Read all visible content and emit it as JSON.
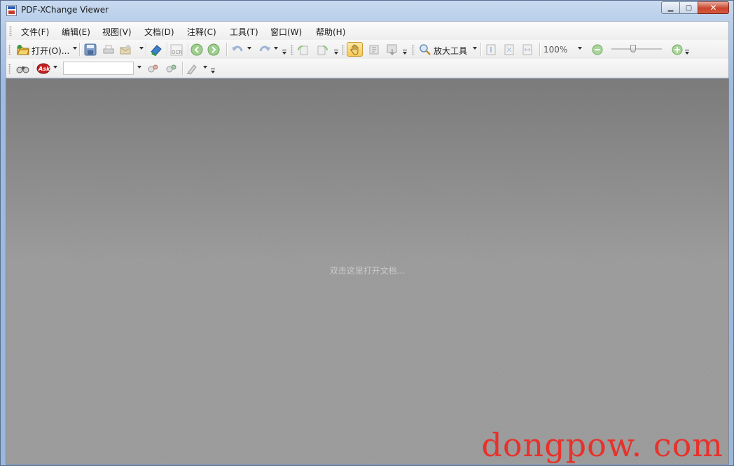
{
  "window": {
    "title": "PDF-XChange Viewer"
  },
  "menu": [
    {
      "label": "文件(F)"
    },
    {
      "label": "编辑(E)"
    },
    {
      "label": "视图(V)"
    },
    {
      "label": "文档(D)"
    },
    {
      "label": "注释(C)"
    },
    {
      "label": "工具(T)"
    },
    {
      "label": "窗口(W)"
    },
    {
      "label": "帮助(H)"
    }
  ],
  "toolbar": {
    "open_label": "打开(O)...",
    "zoom_tool_label": "放大工具",
    "zoom_value": "100%",
    "zoom_slider_level": 0.42,
    "search_value": ""
  },
  "document_area": {
    "hint": "双击这里打开文档..."
  },
  "watermark": "dongpow. com",
  "colors": {
    "title_bg": "#c8daf0",
    "close_button": "#c8452d",
    "doc_bg": "#9a9a9a",
    "watermark": "#e8312b"
  }
}
